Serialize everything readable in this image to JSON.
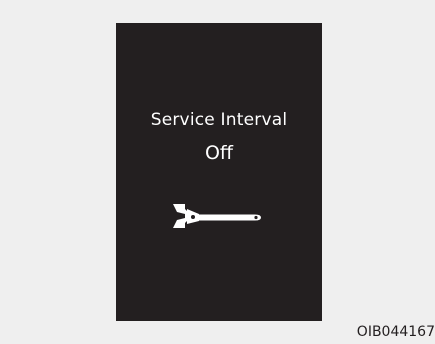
{
  "display": {
    "title": "Service Interval",
    "status": "Off",
    "icon": "wrench-icon",
    "background_color": "#231f20",
    "text_color": "#ffffff"
  },
  "caption": "OIB044167"
}
